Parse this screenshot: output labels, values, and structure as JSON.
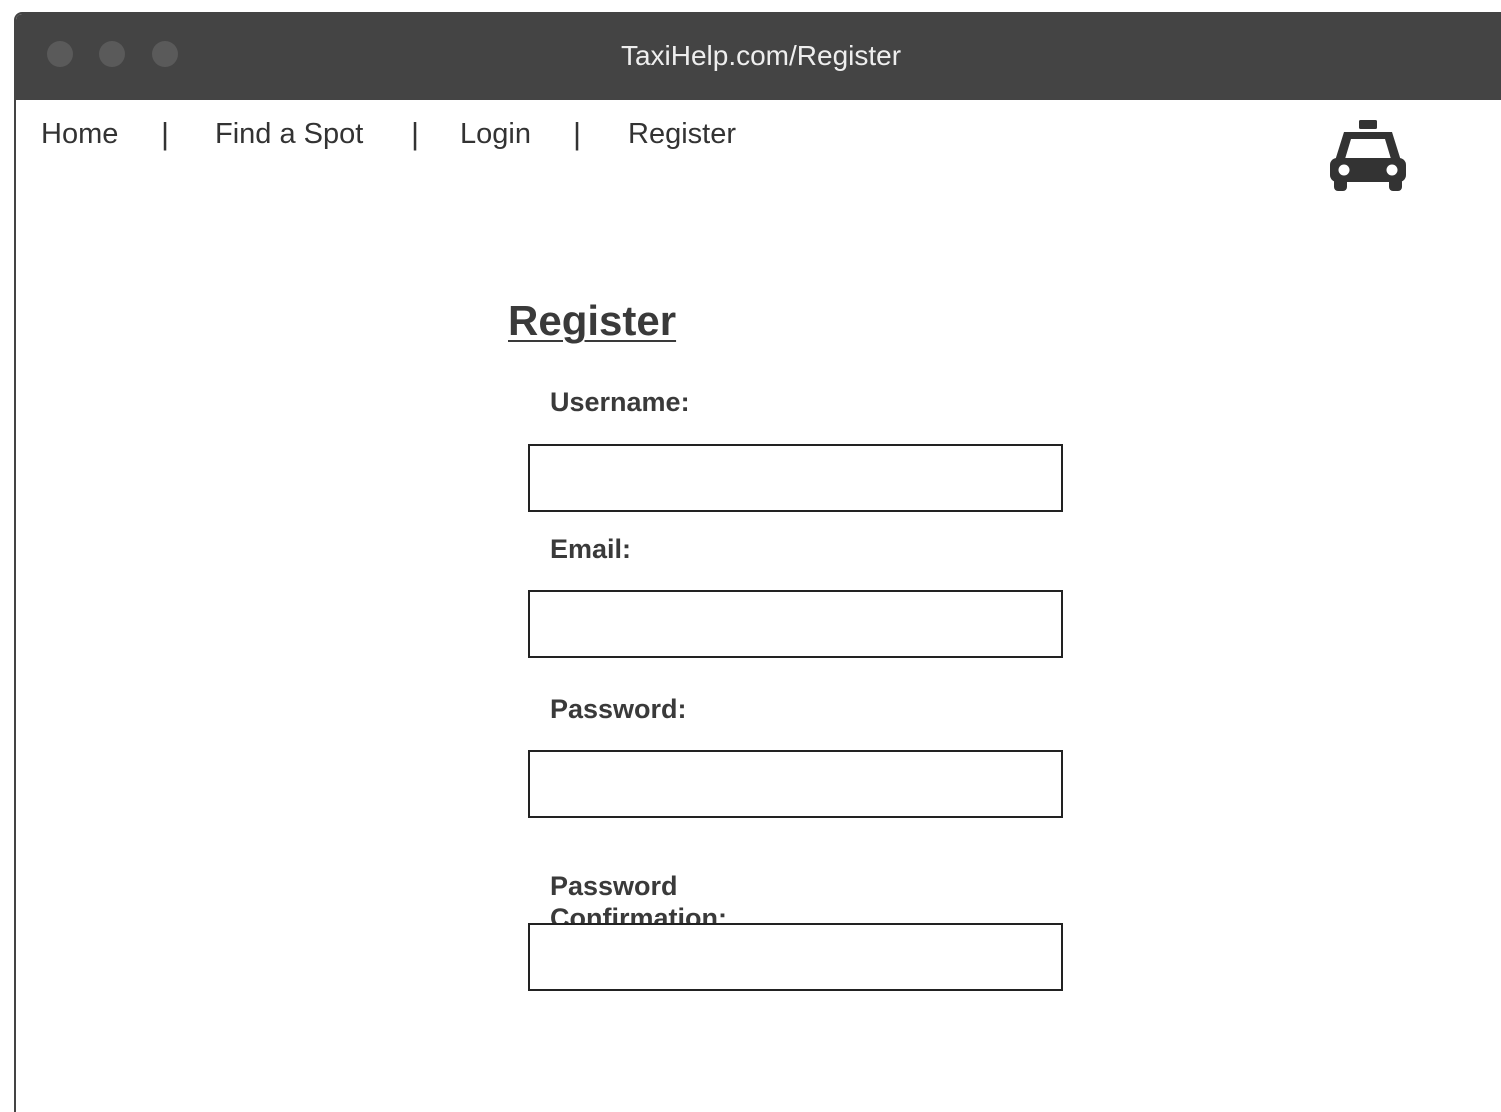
{
  "window": {
    "title": "TaxiHelp.com/Register"
  },
  "nav": {
    "items": [
      {
        "label": "Home"
      },
      {
        "label": "Find a Spot"
      },
      {
        "label": "Login"
      },
      {
        "label": "Register"
      }
    ],
    "separator": "|"
  },
  "logo": {
    "icon": "taxi-icon"
  },
  "form": {
    "title": "Register",
    "fields": [
      {
        "label": "Username:",
        "value": "",
        "placeholder": ""
      },
      {
        "label": "Email:",
        "value": "",
        "placeholder": ""
      },
      {
        "label": "Password:",
        "value": "",
        "placeholder": ""
      },
      {
        "label": "Password Confirmation:",
        "value": "",
        "placeholder": ""
      }
    ]
  }
}
